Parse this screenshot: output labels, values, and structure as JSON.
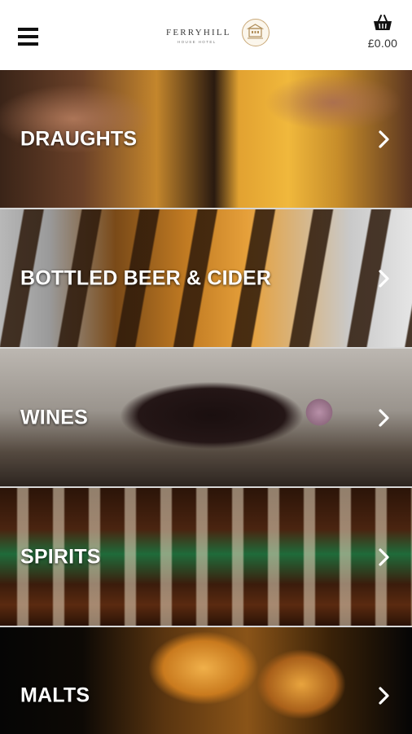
{
  "header": {
    "logo_name": "FERRYHILL",
    "logo_sub": "HOUSE HOTEL",
    "basket_total": "£0.00",
    "icons": {
      "menu": "hamburger-menu-icon",
      "basket": "basket-icon",
      "crest": "hotel-crest-icon"
    }
  },
  "categories": [
    {
      "label": "DRAUGHTS"
    },
    {
      "label": "BOTTLED BEER & CIDER"
    },
    {
      "label": "WINES"
    },
    {
      "label": "SPIRITS"
    },
    {
      "label": "MALTS"
    }
  ],
  "colors": {
    "header_bg": "#ffffff",
    "label_text": "#ffffff",
    "divider": "#d7d7d7",
    "crest_gold": "#c9a877"
  }
}
